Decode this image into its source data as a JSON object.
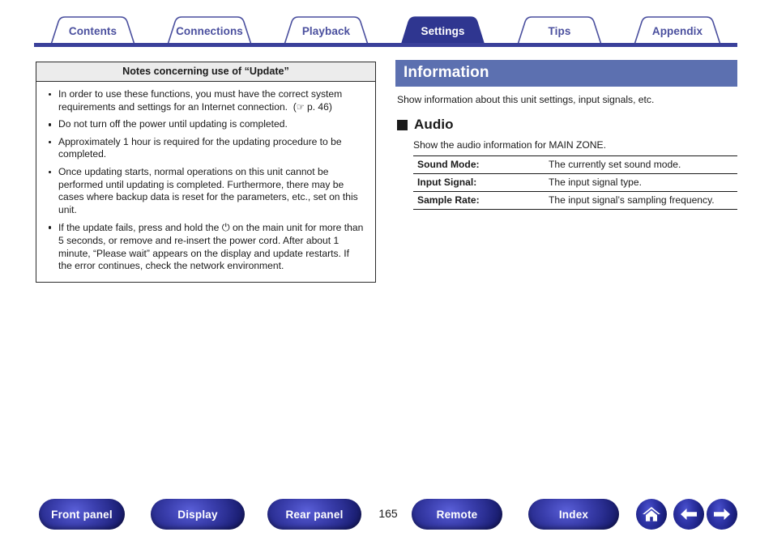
{
  "tabs": [
    {
      "label": "Contents",
      "active": false
    },
    {
      "label": "Connections",
      "active": false
    },
    {
      "label": "Playback",
      "active": false
    },
    {
      "label": "Settings",
      "active": true
    },
    {
      "label": "Tips",
      "active": false
    },
    {
      "label": "Appendix",
      "active": false
    }
  ],
  "notes_box": {
    "header": "Notes concerning use of “Update”",
    "items": [
      {
        "text_before": "In order to use these functions, you must have the correct system requirements and settings for an Internet connection.  (",
        "icon": "pointing-hand-icon",
        "link_text": "p. 46",
        "text_after": ")"
      },
      {
        "text_before": "Do not turn off the power until updating is completed."
      },
      {
        "text_before": "Approximately 1 hour is required for the updating procedure to be completed."
      },
      {
        "text_before": "Once updating starts, normal operations on this unit cannot be performed until updating is completed. Furthermore, there may be cases where backup data is reset for the parameters, etc., set on this unit."
      },
      {
        "text_before": "If the update fails, press and hold the ",
        "icon": "power-icon",
        "glyph": "⏻",
        "text_after": " on the main unit for more than 5 seconds, or remove and re-insert the power cord. After about 1 minute, “Please wait” appears on the display and update restarts. If the error continues, check the network environment."
      }
    ]
  },
  "information": {
    "heading": "Information",
    "description": "Show information about this unit settings, input signals, etc.",
    "audio": {
      "title": "Audio",
      "description": "Show the audio information for MAIN ZONE.",
      "rows": [
        {
          "key": "Sound Mode:",
          "value": "The currently set sound mode."
        },
        {
          "key": "Input Signal:",
          "value": "The input signal type."
        },
        {
          "key": "Sample Rate:",
          "value": "The input signal’s sampling frequency."
        }
      ]
    }
  },
  "footer": {
    "buttons": [
      {
        "label": "Front panel"
      },
      {
        "label": "Display"
      },
      {
        "label": "Rear panel"
      },
      {
        "label": "Remote"
      },
      {
        "label": "Index"
      }
    ],
    "page_number": "165",
    "icons": [
      {
        "name": "home-icon"
      },
      {
        "name": "back-arrow-icon"
      },
      {
        "name": "forward-arrow-icon"
      }
    ]
  },
  "colors": {
    "tab_active_bg": "#2f3690",
    "tab_outline": "#4a4f9e",
    "tab_rule": "#3a409a",
    "info_bar_bg": "#5c70b0",
    "button_blue": "#2b2f93",
    "notes_header_bg": "#ececec"
  }
}
